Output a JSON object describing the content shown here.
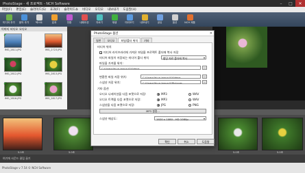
{
  "window": {
    "title": "PhotoStage - 새 프로젝트 - NCH Software",
    "controls": [
      "–",
      "□",
      "✕"
    ]
  },
  "menu": [
    "파일(F)",
    "편집(E)",
    "슬라이드(S)",
    "효과(F)",
    "슬라이드쇼",
    "비디오",
    "오디오",
    "내보내기",
    "도움말(H)"
  ],
  "toolbar": [
    {
      "label": "미디어 추가",
      "color": "#6fb24a"
    },
    {
      "label": "음악 추가",
      "color": "#4a90d9"
    },
    {
      "label": "텍스트",
      "color": "#d9d9d9"
    },
    {
      "label": "효과",
      "color": "#f0a030"
    },
    {
      "label": "전환",
      "color": "#c05ad0"
    },
    {
      "label": "내레이션",
      "color": "#e05050"
    },
    {
      "label": "자르기",
      "color": "#50c0c0"
    },
    {
      "label": "재생",
      "color": "#40b040"
    },
    {
      "label": "미리보기",
      "color": "#5a9ae0"
    },
    {
      "label": "내보내기",
      "color": "#e0b030"
    },
    {
      "label": "공유",
      "color": "#70a0e0"
    },
    {
      "label": "옵션",
      "color": "#d0d0d0"
    },
    {
      "label": "NCH 제품",
      "color": "#e07030"
    }
  ],
  "library": {
    "tabs": [
      "이미지",
      "비디오",
      "오디오"
    ],
    "thumbs": [
      {
        "caption": "IMG_2811.JPG",
        "checked": true
      },
      {
        "caption": "IMG_2723.JPG",
        "checked": false
      },
      {
        "caption": "IMG_2812.JPG",
        "checked": true
      },
      {
        "caption": "IMG_2813.JPG",
        "checked": true
      },
      {
        "caption": "IMG_2816.JPG",
        "checked": true
      },
      {
        "caption": "IMG_2817.JPG",
        "checked": true
      }
    ]
  },
  "timeline": {
    "captions": [
      "5.0초",
      "5.0초",
      "5.0초",
      "5.0초",
      "5.0초"
    ],
    "audio_hint": "여기에 사운드 클립 끌기"
  },
  "status": "PhotoStage v 7.54 © NCH Software",
  "dialog": {
    "title": "PhotoStage 옵션",
    "close": "✕",
    "tabs": [
      "일반",
      "오디오",
      "파일/폴더 위치",
      "기타"
    ],
    "active_tab": "파일/폴더 위치",
    "section_folders": "미디어 위치",
    "chk_copy_label": "미디어 라이브러리에 가져온 파일을 프로젝트 폴더에 복사 저장",
    "media_path_label": "미디어 파일이 저장되는 미디어 폴더 위치",
    "media_path_select": "할당 자료 폴더에 복사",
    "folder_label": "파일을 가져올 위치:",
    "folder_path": "C:\\Users\\Yuun Jeong K\\Videos",
    "browse": "...",
    "project_label": "변환된 파일 저장 위치:",
    "project_path": "C:\\Users\\Yuun Jeong K\\Videos",
    "temp_label": "스냅샷 저장 위치:",
    "temp_path": "C:\\Users\\Yuun Jeong K\\Pictures",
    "section_other": "기타 옵션",
    "r1_label": "오디오 나레이션을 다음 포맷으로 저장:",
    "r1_a": "MP3",
    "r1_b": "WAV",
    "r2_label": "오디오 트랙을 다음 포맷으로 저장:",
    "r2_a": "MP3",
    "r2_b": "WAV",
    "r3_label": "스냅샷을 다음 포맷으로 저장:",
    "r3_a": "JPG",
    "r3_b": "PNG",
    "mp3_button": "MP3 설정...",
    "res_label": "스냅샷 해상도:",
    "res_value": "1920 x 1080 - HD 1080p",
    "btn_ok": "확인",
    "btn_cancel": "취소",
    "btn_help": "도움말"
  }
}
